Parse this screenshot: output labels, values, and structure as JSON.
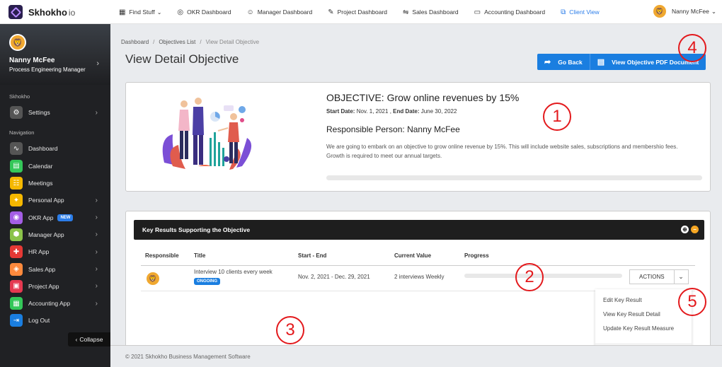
{
  "brand": {
    "name": "Skhokho",
    "suffix": "io"
  },
  "topnav": [
    {
      "label": "Find Stuff",
      "icon": "grid-icon",
      "glyph": "▦",
      "dropdown": true
    },
    {
      "label": "OKR Dashboard",
      "icon": "target-icon",
      "glyph": "◎"
    },
    {
      "label": "Manager Dashboard",
      "icon": "user-icon",
      "glyph": "☺"
    },
    {
      "label": "Project Dashboard",
      "icon": "edit-icon",
      "glyph": "✎"
    },
    {
      "label": "Sales Dashboard",
      "icon": "handshake-icon",
      "glyph": "⇋"
    },
    {
      "label": "Accounting Dashboard",
      "icon": "money-icon",
      "glyph": "▭"
    },
    {
      "label": "Client View",
      "icon": "external-link-icon",
      "glyph": "⧉",
      "active": true
    }
  ],
  "top_user": {
    "name": "Nanny McFee"
  },
  "profile": {
    "name": "Nanny McFee",
    "role": "Process Engineering Manager"
  },
  "sidebar": {
    "section1": "Skhokho",
    "settings": {
      "label": "Settings",
      "icon": "gear-icon",
      "glyph": "⚙",
      "color": "#555555"
    },
    "section2": "Navigation",
    "items": [
      {
        "label": "Dashboard",
        "icon": "pulse-icon",
        "glyph": "∿",
        "color": "#555555",
        "chevron": false
      },
      {
        "label": "Calendar",
        "icon": "calendar-icon",
        "glyph": "▤",
        "color": "#34c759",
        "chevron": false
      },
      {
        "label": "Meetings",
        "icon": "meetings-icon",
        "glyph": "☷",
        "color": "#f5b800",
        "chevron": false
      },
      {
        "label": "Personal App",
        "icon": "personal-icon",
        "glyph": "✦",
        "color": "#f5b800",
        "chevron": true
      },
      {
        "label": "OKR App",
        "icon": "okr-icon",
        "glyph": "◉",
        "color": "#a45ee5",
        "chevron": true,
        "badge": "NEW"
      },
      {
        "label": "Manager App",
        "icon": "manager-icon",
        "glyph": "⬢",
        "color": "#8bc34a",
        "chevron": true
      },
      {
        "label": "HR App",
        "icon": "hr-icon",
        "glyph": "✚",
        "color": "#e53935",
        "chevron": true
      },
      {
        "label": "Sales App",
        "icon": "tag-icon",
        "glyph": "◈",
        "color": "#ff8a3d",
        "chevron": true
      },
      {
        "label": "Project App",
        "icon": "project-icon",
        "glyph": "▣",
        "color": "#e53950",
        "chevron": true
      },
      {
        "label": "Accounting App",
        "icon": "calculator-icon",
        "glyph": "▦",
        "color": "#34c759",
        "chevron": true
      },
      {
        "label": "Log Out",
        "icon": "logout-icon",
        "glyph": "⇥",
        "color": "#1a7ee0",
        "chevron": false
      }
    ],
    "collapse": "Collapse"
  },
  "breadcrumb": {
    "items": [
      "Dashboard",
      "Objectives List"
    ],
    "current": "View Detail Objective"
  },
  "page_title": "View Detail Objective",
  "buttons": {
    "go_back": "Go Back",
    "pdf": "View Objective PDF Document"
  },
  "objective": {
    "title": "OBJECTIVE: Grow online revenues by 15%",
    "start_label": "Start Date:",
    "start_value": "Nov. 1, 2021",
    "end_label": "End Date:",
    "end_value": "June 30, 2022",
    "responsible": "Responsible Person: Nanny McFee",
    "description": "We are going to embark on an objective to grow online revenue by 15%. This will include website sales, subscriptions and membershio fees. Growth is required to meet our annual targets.",
    "progress": 0
  },
  "key_results": {
    "header": "Key Results Supporting the Objective",
    "columns": [
      "Responsible",
      "Title",
      "Start - End",
      "Current Value",
      "Progress"
    ],
    "rows": [
      {
        "title": "Interview 10 clients every week",
        "status": "ONGOING",
        "dates": "Nov. 2, 2021 - Dec. 29, 2021",
        "value": "2 interviews Weekly",
        "progress": 0
      }
    ],
    "actions_label": "ACTIONS",
    "dropdown": [
      "Edit Key Result",
      "View Key Result Detail",
      "Update Key Result Measure"
    ]
  },
  "footer": "© 2021 Skhokho Business Management Software",
  "annotations": [
    "1",
    "2",
    "3",
    "4",
    "5"
  ],
  "colors": {
    "accent": "#1a7ee0",
    "annotation": "#e3191c",
    "sidebar_bg": "#202124"
  }
}
